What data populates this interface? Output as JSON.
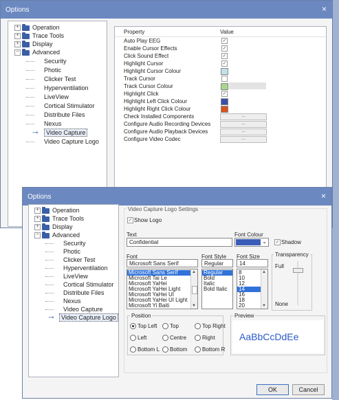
{
  "options_dialog_back": {
    "title": "Options",
    "close": "×",
    "tree": {
      "folders": [
        "Operation",
        "Trace Tools",
        "Display",
        "Advanced"
      ],
      "children": [
        "Security",
        "Photic",
        "Clicker Test",
        "Hyperventilation",
        "LiveView",
        "Cortical Stimulator",
        "Distribute Files",
        "Nexus",
        "Video Capture",
        "Video Capture Logo"
      ],
      "selected": "Video Capture"
    },
    "grid": {
      "headers": [
        "Property",
        "Value"
      ],
      "rows": [
        {
          "name": "Auto Play EEG",
          "kind": "check",
          "value": "✓"
        },
        {
          "name": "Enable Cursor Effects",
          "kind": "check",
          "value": "✓"
        },
        {
          "name": "Click Sound Effect",
          "kind": "check",
          "value": "✓"
        },
        {
          "name": "Highlight Cursor",
          "kind": "check",
          "value": "✓"
        },
        {
          "name": "Highlight Cursor Colour",
          "kind": "color",
          "value": "#bfe3e8"
        },
        {
          "name": "Track Cursor",
          "kind": "check",
          "value": ""
        },
        {
          "name": "Track Cursor Colour",
          "kind": "color",
          "value": "#a6d68c"
        },
        {
          "name": "Highlight Click",
          "kind": "check",
          "value": "✓"
        },
        {
          "name": "Highlight Left Click Colour",
          "kind": "color",
          "value": "#3b4fa8"
        },
        {
          "name": "Highlight Right Click Colour",
          "kind": "color",
          "value": "#d9531e"
        },
        {
          "name": "Check Installed Components",
          "kind": "button",
          "value": "..."
        },
        {
          "name": "Configure Audio Recording Devices",
          "kind": "button",
          "value": "..."
        },
        {
          "name": "Configure Audio Playback Devices",
          "kind": "button",
          "value": "..."
        },
        {
          "name": "Configure Video Codec",
          "kind": "button",
          "value": "..."
        }
      ]
    }
  },
  "options_dialog_front": {
    "title": "Options",
    "close": "×",
    "tree": {
      "selected": "Video Capture Logo"
    },
    "settings": {
      "group_title": "Video Capture Logo Settings",
      "show_logo_label": "Show Logo",
      "show_logo_checked": "✓",
      "text_label": "Text",
      "text_value": "Confidential",
      "font_colour_label": "Font Colour",
      "font_colour_value": "#3a5cb8",
      "shadow_label": "Shadow",
      "shadow_checked": "✓",
      "font_label": "Font",
      "font_value": "Microsoft Sans Serif",
      "font_list": [
        "Microsoft Sans Serif",
        "Microsoft Tai Le",
        "Microsoft YaHei",
        "Microsoft YaHei Light",
        "Microsoft YaHei UI",
        "Microsoft YaHei UI Light",
        "Microsoft Yi Baiti"
      ],
      "font_style_label": "Font Style",
      "font_style_value": "Regular",
      "font_style_list": [
        "Regular",
        "Bold",
        "Italic",
        "Bold Italic"
      ],
      "font_size_label": "Font Size",
      "font_size_value": "14",
      "font_size_list": [
        "8",
        "10",
        "12",
        "14",
        "16",
        "18",
        "20"
      ],
      "transparency_label": "Transparency",
      "transparency_full": "Full",
      "transparency_none": "None",
      "position_label": "Position",
      "positions": [
        "Top Left",
        "Top",
        "Top Right",
        "Left",
        "Centre",
        "Right",
        "Bottom L",
        "Bottom",
        "Bottom R"
      ],
      "position_selected": "Top Left",
      "preview_label": "Preview",
      "preview_text": "AaBbCcDdEe"
    },
    "buttons": {
      "ok": "OK",
      "cancel": "Cancel"
    }
  },
  "colors": {
    "titlebar": "#6b88c0",
    "selection": "#3072d8",
    "preview_text": "#2a5ac8",
    "tree_folder": "#3b5fa6"
  }
}
